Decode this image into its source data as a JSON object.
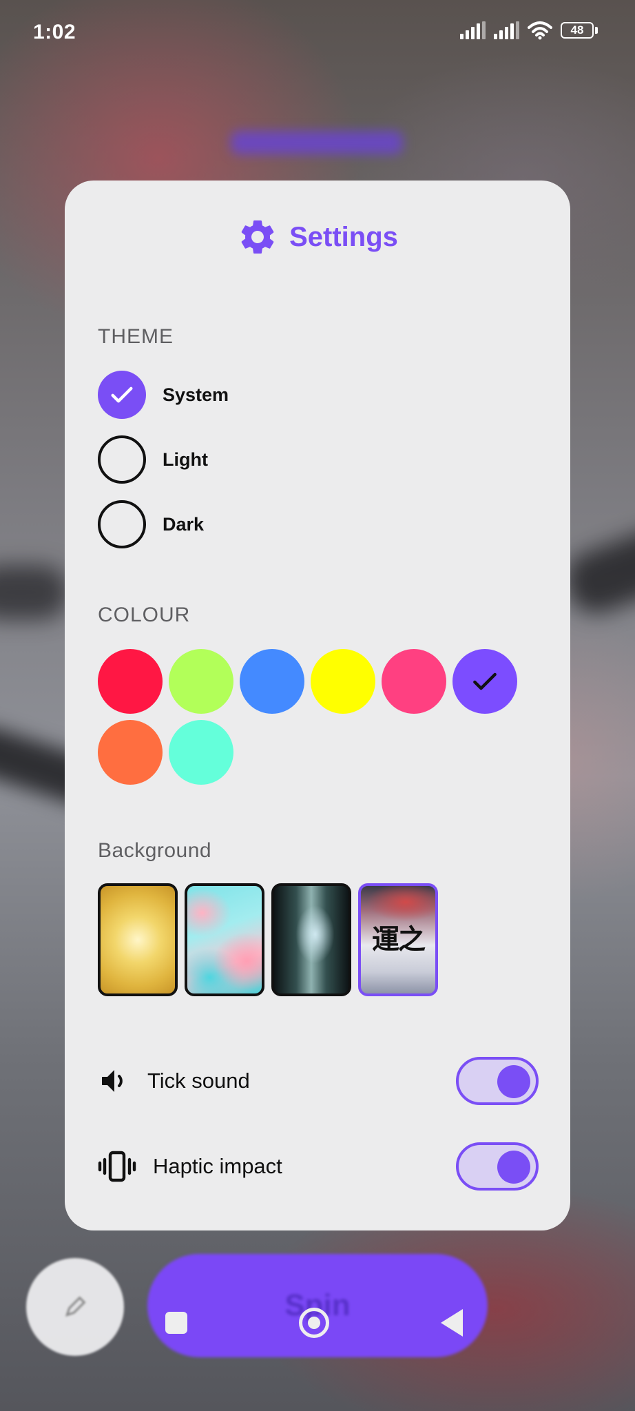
{
  "status_bar": {
    "time": "1:02",
    "battery": "48"
  },
  "settings": {
    "title": "Settings",
    "theme": {
      "label": "THEME",
      "options": [
        {
          "label": "System",
          "selected": true
        },
        {
          "label": "Light",
          "selected": false
        },
        {
          "label": "Dark",
          "selected": false
        }
      ]
    },
    "colour": {
      "label": "COLOUR",
      "swatches": [
        "#ff1744",
        "#b2ff59",
        "#448aff",
        "#ffff00",
        "#ff4081",
        "#7c4dff",
        "#ff6e40",
        "#64ffda"
      ],
      "selected_index": 5
    },
    "background": {
      "label": "Background",
      "thumbnail_4_text": "運之",
      "selected_index": 3
    },
    "toggles": [
      {
        "label": "Tick sound",
        "icon": "speaker-icon",
        "on": true
      },
      {
        "label": "Haptic impact",
        "icon": "vibration-icon",
        "on": true
      }
    ]
  },
  "bottom": {
    "spin_label": "Spin"
  },
  "colors": {
    "accent": "#7a4ef5",
    "card_bg": "#ececed"
  }
}
